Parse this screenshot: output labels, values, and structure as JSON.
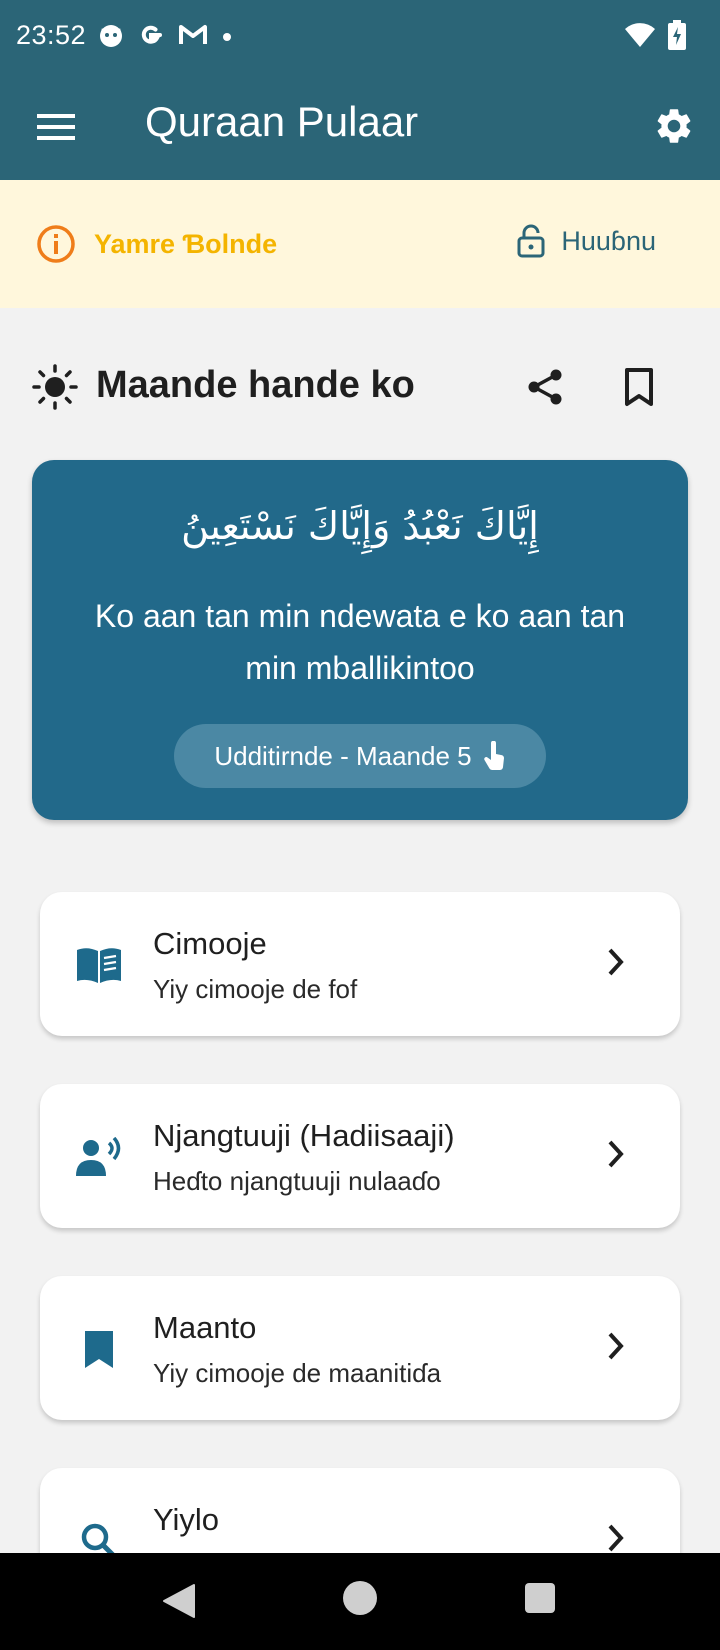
{
  "status": {
    "time": "23:52",
    "left_icons": [
      "cat-icon",
      "google-icon",
      "gmail-icon",
      "dot-icon"
    ],
    "right_icons": [
      "wifi-icon",
      "battery-charging-icon"
    ]
  },
  "app_bar": {
    "title": "Quraan Pulaar",
    "menu_icon": "hamburger-menu-icon",
    "settings_icon": "gear-icon"
  },
  "banner": {
    "title": "Yamre Ɓolnde",
    "login_label": "Huuɓnu",
    "colors": {
      "background": "#fff7dc",
      "title": "#f4b400",
      "info_icon": "#ef7d1a",
      "login": "#2b6577"
    }
  },
  "day": {
    "title": "Maande hande ko"
  },
  "verse": {
    "arabic": "إِيَّاكَ نَعْبُدُ وَإِيَّاكَ نَسْتَعِينُ",
    "translation": "Ko aan tan min ndewata e ko aan tan min mballikintoo",
    "reference": "Udditirnde - Maande 5",
    "colors": {
      "card": "#22698a",
      "pill": "#4b88a4"
    }
  },
  "menu": [
    {
      "title": "Cimooje",
      "subtitle": "Yiy cimooje de fof",
      "icon": "book-open-icon"
    },
    {
      "title": "Njangtuuji (Hadiisaaji)",
      "subtitle": "Heɗto njangtuuji nulaaɗo",
      "icon": "speaker-person-icon"
    },
    {
      "title": "Maanto",
      "subtitle": "Yiy cimooje de maanitiɗa",
      "icon": "bookmark-icon"
    },
    {
      "title": "Yiylo",
      "subtitle": "",
      "icon": "search-icon"
    }
  ],
  "theme": {
    "primary": "#2b6577",
    "accent": "#1e6a8c"
  }
}
